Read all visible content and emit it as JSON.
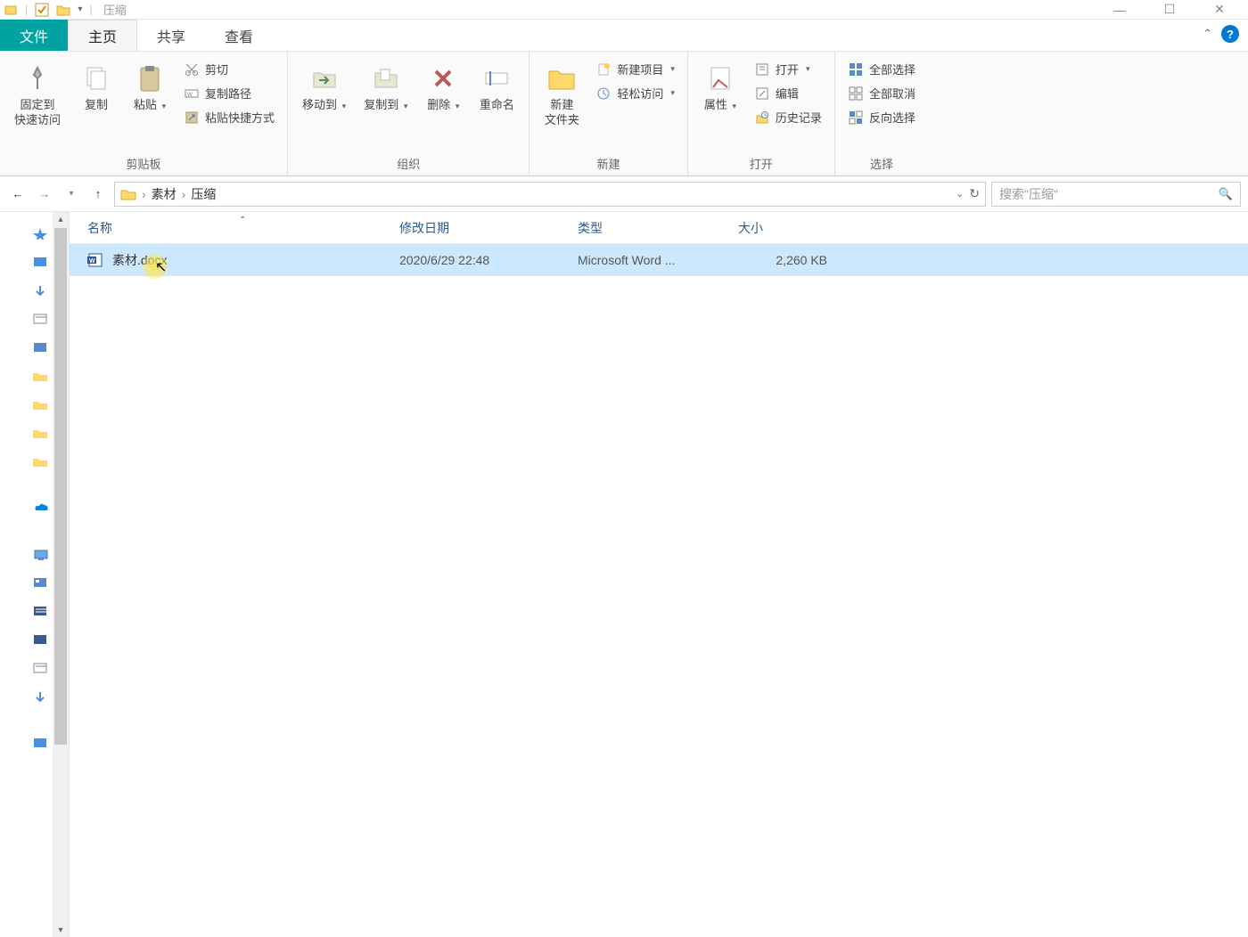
{
  "window": {
    "title": "压缩",
    "controls": {
      "minimize": "—",
      "maximize": "☐",
      "close": "✕"
    }
  },
  "tabs": {
    "file": "文件",
    "home": "主页",
    "share": "共享",
    "view": "查看"
  },
  "ribbon": {
    "clipboard": {
      "label": "剪贴板",
      "pin": "固定到\n快速访问",
      "copy": "复制",
      "paste": "粘贴",
      "cut": "剪切",
      "copy_path": "复制路径",
      "paste_shortcut": "粘贴快捷方式"
    },
    "organize": {
      "label": "组织",
      "move_to": "移动到",
      "copy_to": "复制到",
      "delete": "删除",
      "rename": "重命名"
    },
    "new": {
      "label": "新建",
      "new_folder": "新建\n文件夹",
      "new_item": "新建项目",
      "easy_access": "轻松访问"
    },
    "open": {
      "label": "打开",
      "properties": "属性",
      "open": "打开",
      "edit": "编辑",
      "history": "历史记录"
    },
    "select": {
      "label": "选择",
      "select_all": "全部选择",
      "select_none": "全部取消",
      "invert": "反向选择"
    }
  },
  "nav": {
    "breadcrumb": {
      "parent": "素材",
      "current": "压缩"
    },
    "search_placeholder": "搜索\"压缩\""
  },
  "columns": {
    "name": "名称",
    "date": "修改日期",
    "type": "类型",
    "size": "大小"
  },
  "files": [
    {
      "name": "素材.docx",
      "date": "2020/6/29 22:48",
      "type": "Microsoft Word ...",
      "size": "2,260 KB"
    }
  ]
}
